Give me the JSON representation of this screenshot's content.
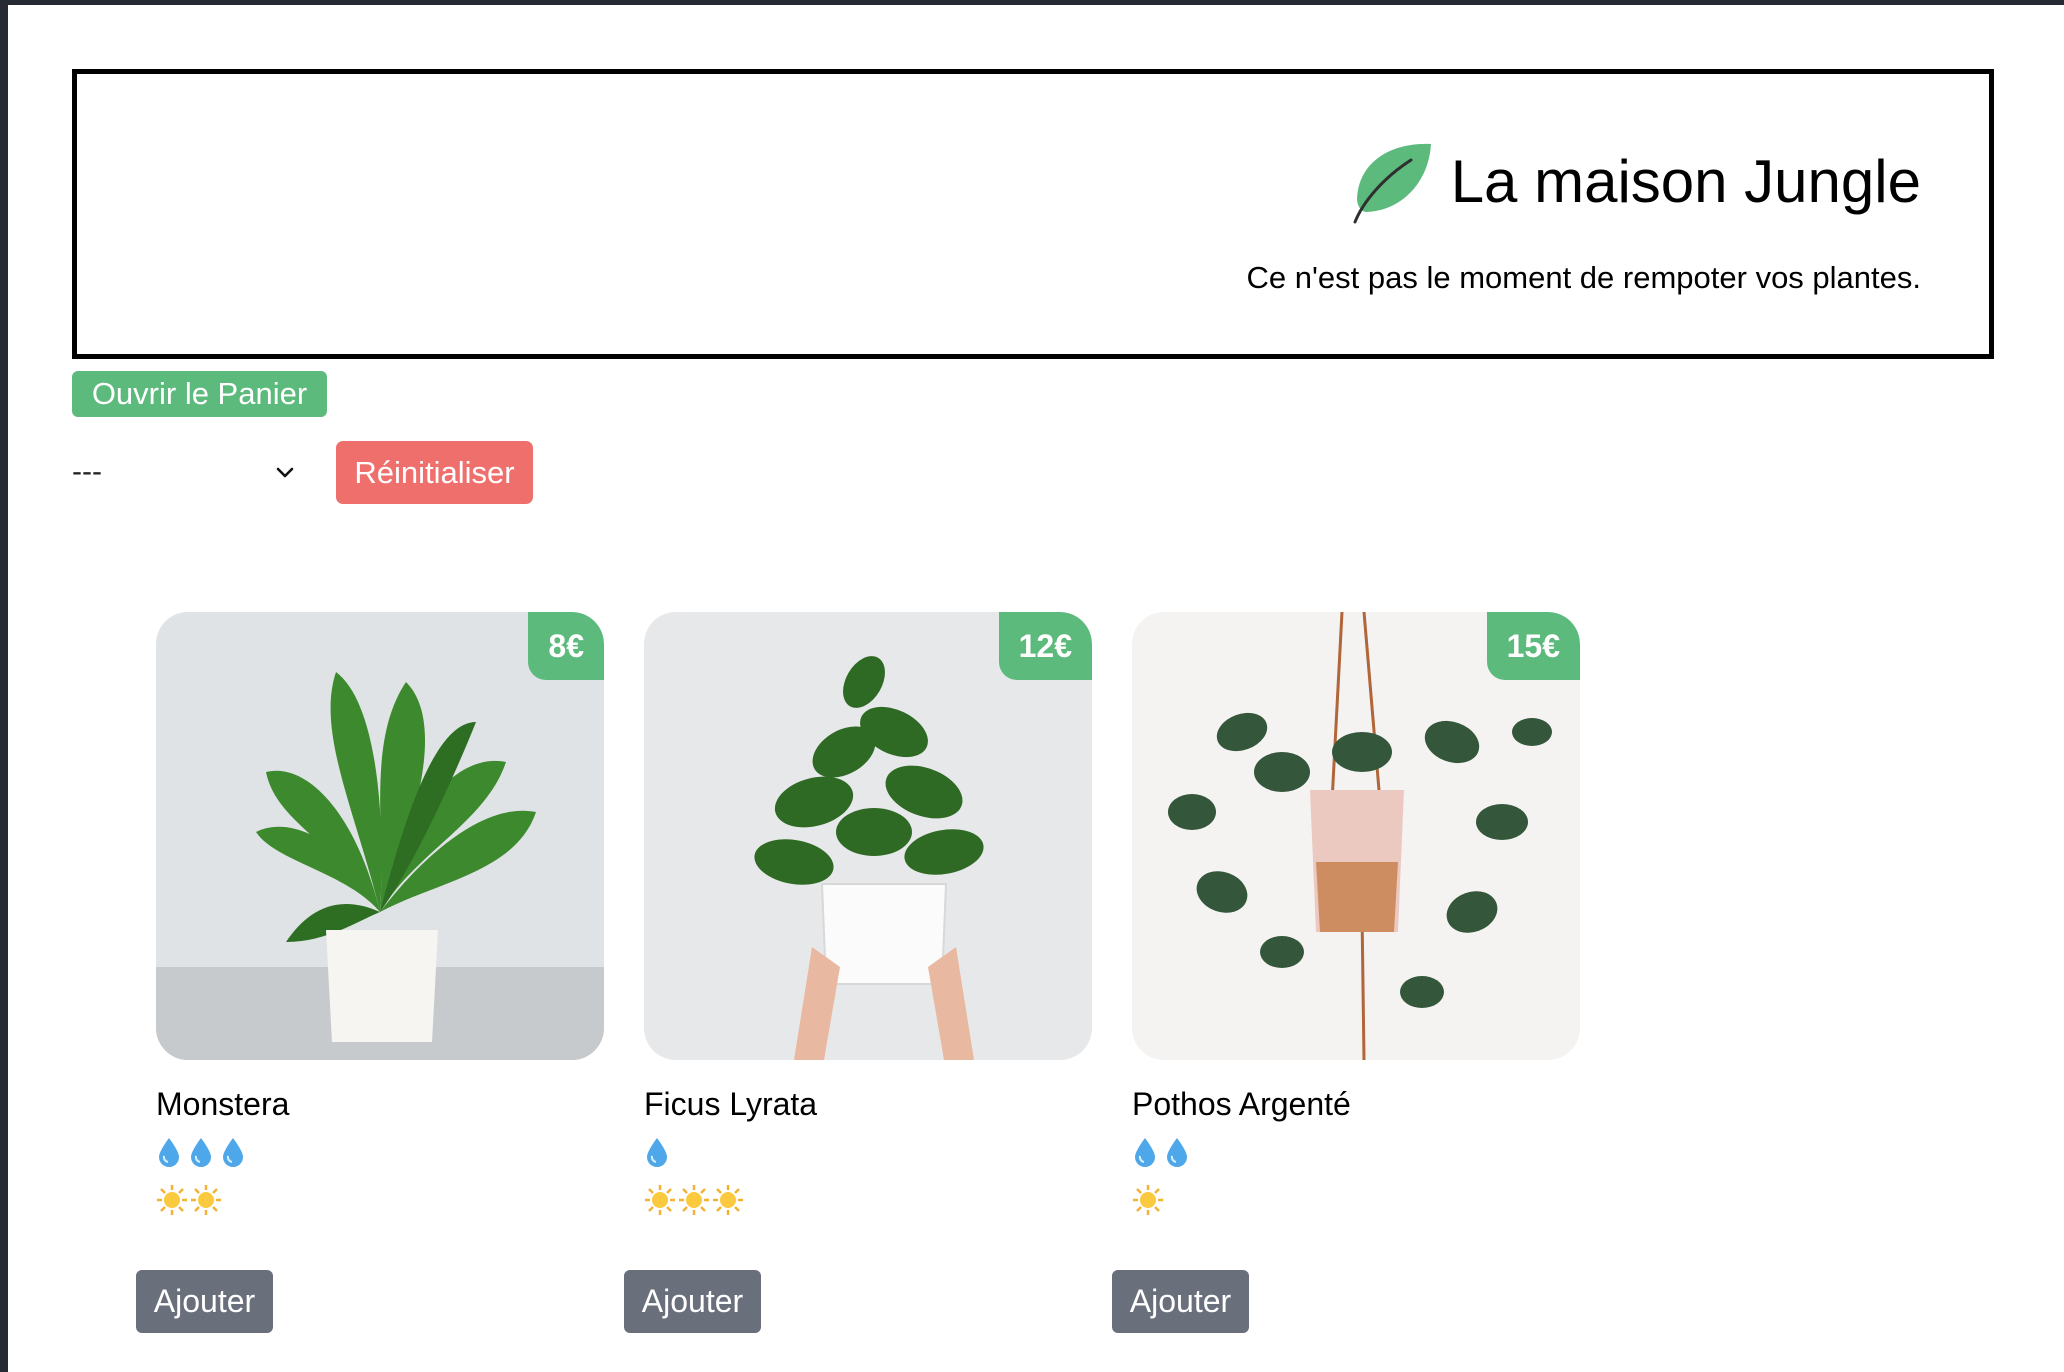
{
  "header": {
    "title": "La maison Jungle",
    "subtitle": "Ce n'est pas le moment de rempoter vos plantes.",
    "logo_icon": "leaf-icon",
    "logo_color": "#5dba7d"
  },
  "cart": {
    "open_label": "Ouvrir le Panier"
  },
  "filter": {
    "selected_value": "---",
    "reset_label": "Réinitialiser"
  },
  "colors": {
    "accent_green": "#5dba7d",
    "reset_red": "#ef6f6c",
    "add_gray": "#6a6f7c"
  },
  "plants": [
    {
      "name": "Monstera",
      "price": "8€",
      "water_level": 3,
      "light_level": 2,
      "add_label": "Ajouter",
      "image": "monstera-plant-in-white-pot"
    },
    {
      "name": "Ficus Lyrata",
      "price": "12€",
      "water_level": 1,
      "light_level": 3,
      "add_label": "Ajouter",
      "image": "ficus-lyrata-held-in-hands"
    },
    {
      "name": "Pothos Argenté",
      "price": "15€",
      "water_level": 2,
      "light_level": 1,
      "add_label": "Ajouter",
      "image": "hanging-silver-pothos"
    }
  ]
}
